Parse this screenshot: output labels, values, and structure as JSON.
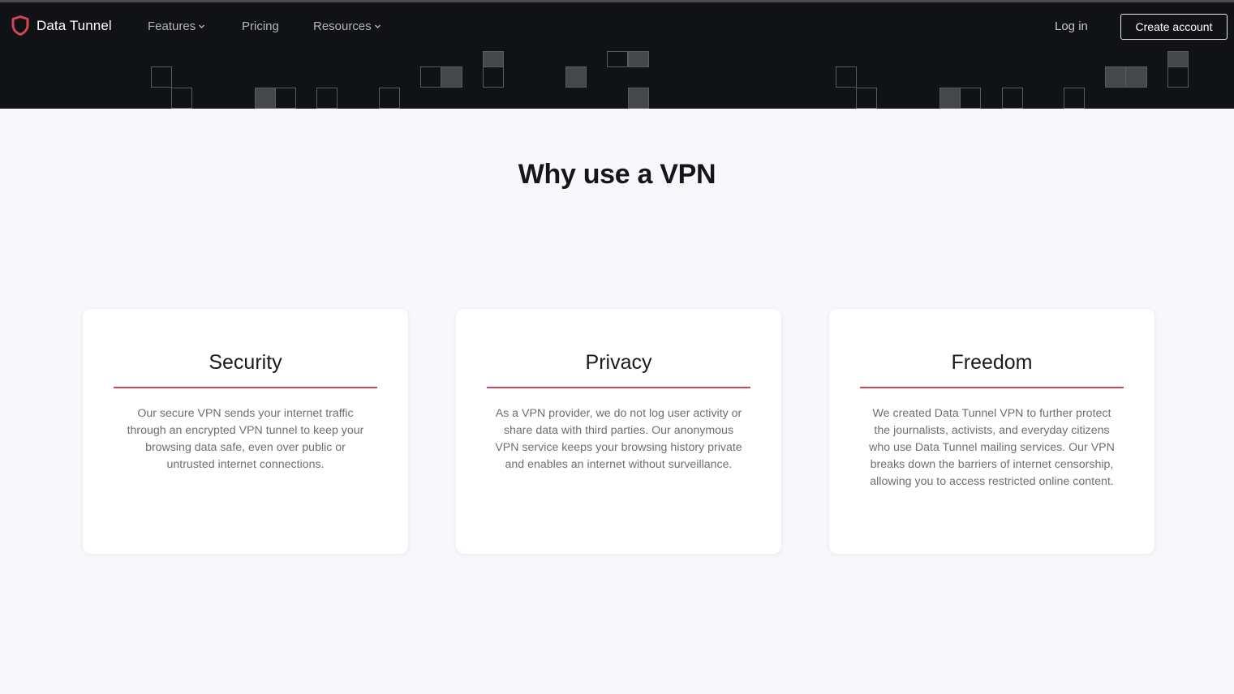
{
  "nav": {
    "brand": "Data Tunnel",
    "links": [
      {
        "label": "Features",
        "dropdown": true
      },
      {
        "label": "Pricing",
        "dropdown": false
      },
      {
        "label": "Resources",
        "dropdown": true
      }
    ],
    "login": "Log in",
    "create_account": "Create account",
    "brand_icon": "shield-icon"
  },
  "section": {
    "title": "Why use a VPN",
    "cards": [
      {
        "title": "Security",
        "text": "Our secure VPN sends your internet traffic through an encrypted VPN tunnel to keep your browsing data safe, even over public or untrusted internet connections."
      },
      {
        "title": "Privacy",
        "text": "As a VPN provider, we do not log user activity or share data with third parties. Our anonymous VPN service keeps your browsing history private and enables an internet without surveillance."
      },
      {
        "title": "Freedom",
        "text": "We created Data Tunnel VPN to further protect the journalists, activists, and everyday citizens who use Data Tunnel mailing services. Our VPN breaks down the barriers of internet censorship, allowing you to access restricted online content."
      }
    ]
  },
  "colors": {
    "accent": "#d0465a",
    "header_bg": "#111215",
    "page_bg": "#f7f7fc"
  }
}
